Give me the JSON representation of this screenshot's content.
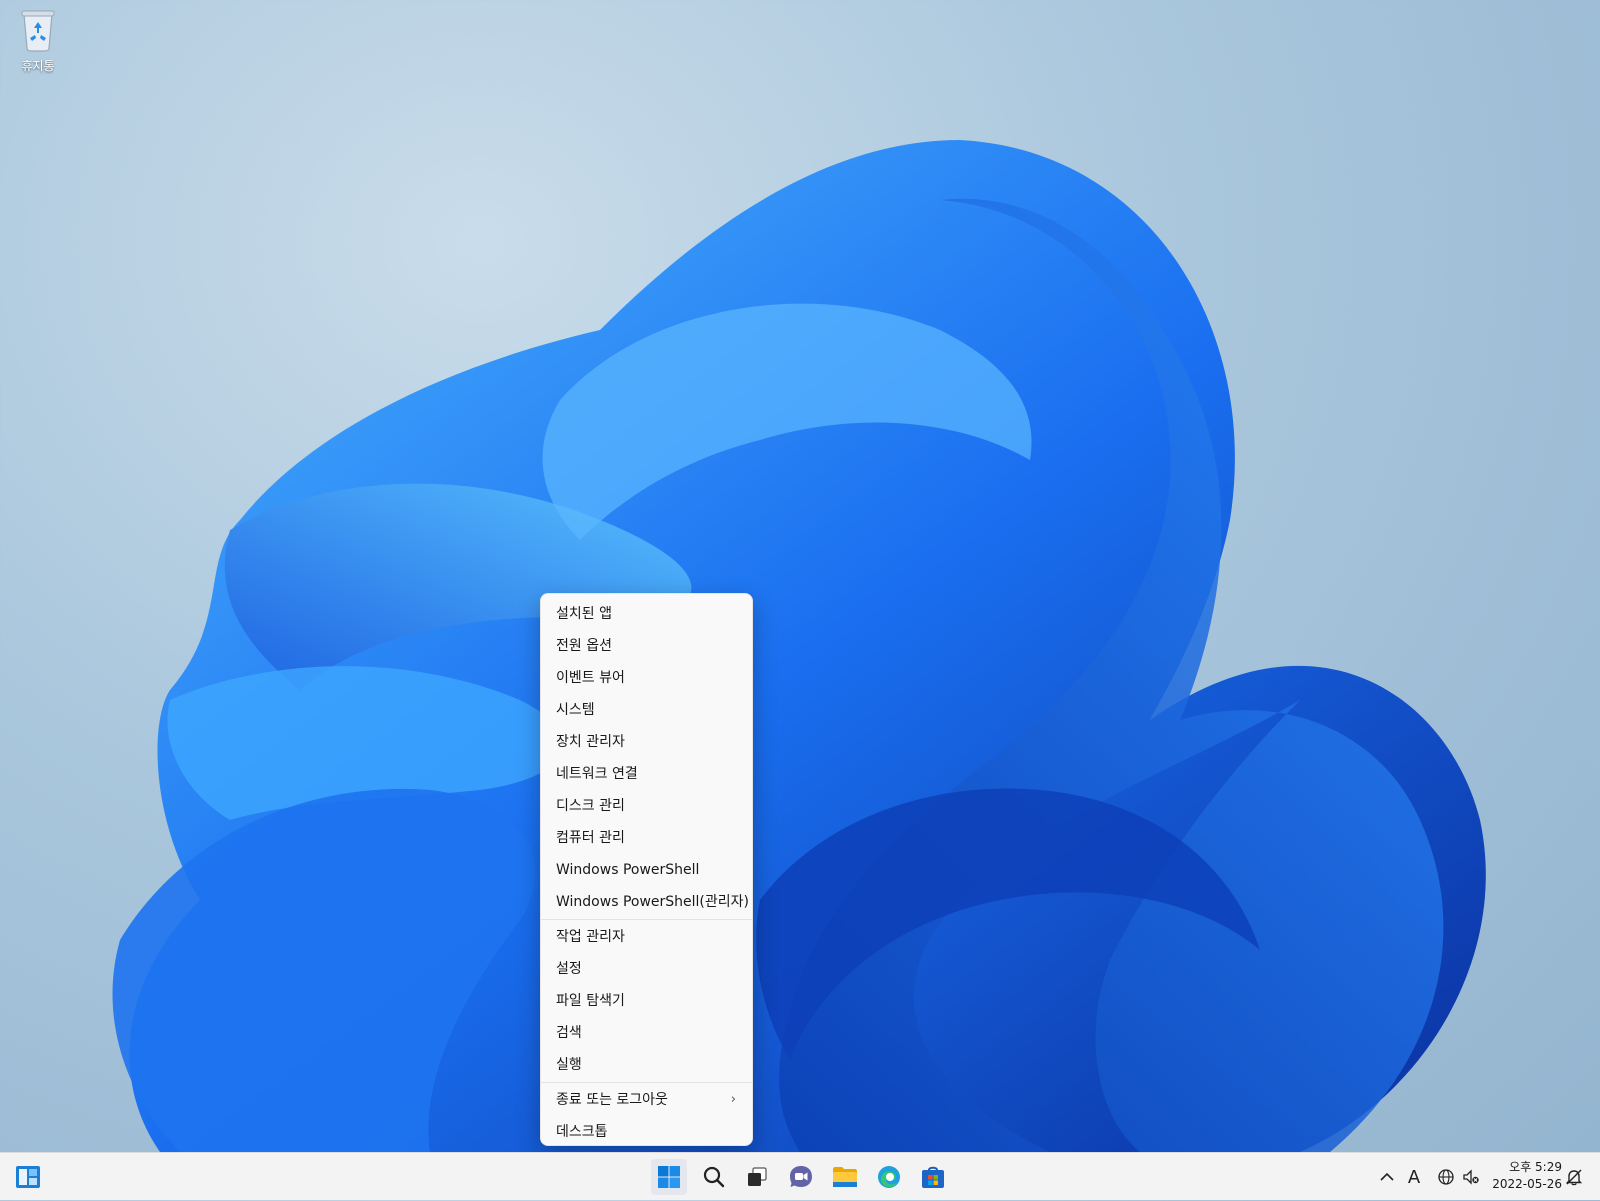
{
  "desktop": {
    "recycle_bin_label": "휴지통"
  },
  "context_menu": {
    "group1": [
      "설치된 앱",
      "전원 옵션",
      "이벤트 뷰어",
      "시스템",
      "장치 관리자",
      "네트워크 연결",
      "디스크 관리",
      "컴퓨터 관리",
      "Windows PowerShell",
      "Windows PowerShell(관리자)"
    ],
    "group2": [
      "작업 관리자",
      "설정",
      "파일 탐색기",
      "검색",
      "실행"
    ],
    "group3": [
      "종료 또는 로그아웃",
      "데스크톱"
    ],
    "submenu_chevron": "›"
  },
  "taskbar": {
    "pinned_icons": [
      "start-icon",
      "search-icon",
      "task-view-icon",
      "chat-icon",
      "file-explorer-icon",
      "edge-icon",
      "store-icon"
    ],
    "tray": {
      "overflow_glyph": "^",
      "ime_glyph": "A"
    },
    "clock": {
      "time": "오후 5:29",
      "date": "2022-05-26"
    }
  },
  "colors": {
    "accent": "#0067c0",
    "menu_bg": "#f9f9f9",
    "taskbar_bg": "#f3f3f3"
  }
}
